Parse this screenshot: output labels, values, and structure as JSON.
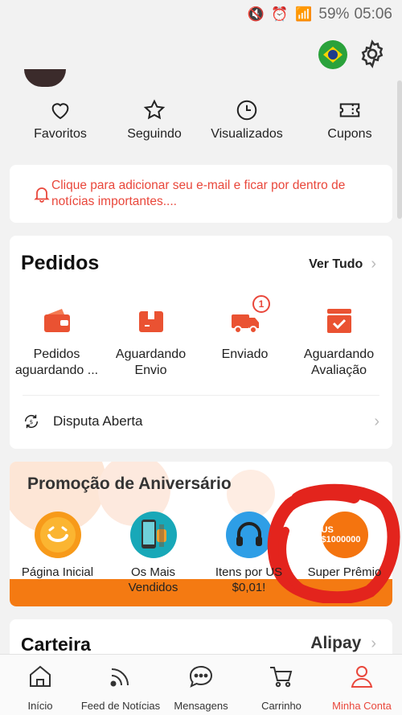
{
  "status_bar": {
    "icons": "🔇 ⏰ 📶",
    "battery": "59%",
    "time": "05:06"
  },
  "shortcuts": [
    {
      "label": "Favoritos",
      "icon": "heart-icon"
    },
    {
      "label": "Seguindo",
      "icon": "star-icon"
    },
    {
      "label": "Visualizados",
      "icon": "clock-icon"
    },
    {
      "label": "Cupons",
      "icon": "ticket-icon"
    }
  ],
  "notice": {
    "text": "Clique para adicionar seu e-mail e ficar por dentro de notícias importantes...."
  },
  "orders": {
    "title": "Pedidos",
    "see_all": "Ver Tudo",
    "items": [
      {
        "label": "Pedidos aguardando ...",
        "icon": "wallet-icon"
      },
      {
        "label": "Aguardando Envio",
        "icon": "box-icon"
      },
      {
        "label": "Enviado",
        "icon": "truck-icon",
        "badge": "1"
      },
      {
        "label": "Aguardando Avaliação",
        "icon": "review-icon"
      }
    ],
    "dispute": "Disputa Aberta"
  },
  "promo": {
    "title": "Promoção de Aniversário",
    "items": [
      {
        "label": "Página Inicial"
      },
      {
        "label": "Os Mais Vendidos"
      },
      {
        "label": "Itens por US $0,01!"
      },
      {
        "label": "Super Prêmio",
        "badge_text": "US $1000000"
      }
    ]
  },
  "wallet": {
    "title": "Carteira",
    "provider": "Alipay"
  },
  "bottom_nav": [
    {
      "label": "Início",
      "icon": "home-icon"
    },
    {
      "label": "Feed de Notícias",
      "icon": "feed-icon"
    },
    {
      "label": "Mensagens",
      "icon": "chat-icon"
    },
    {
      "label": "Carrinho",
      "icon": "cart-icon"
    },
    {
      "label": "Minha Conta",
      "icon": "account-icon",
      "active": true
    }
  ],
  "colors": {
    "accent": "#e9473b",
    "promo_orange": "#f47a12"
  }
}
